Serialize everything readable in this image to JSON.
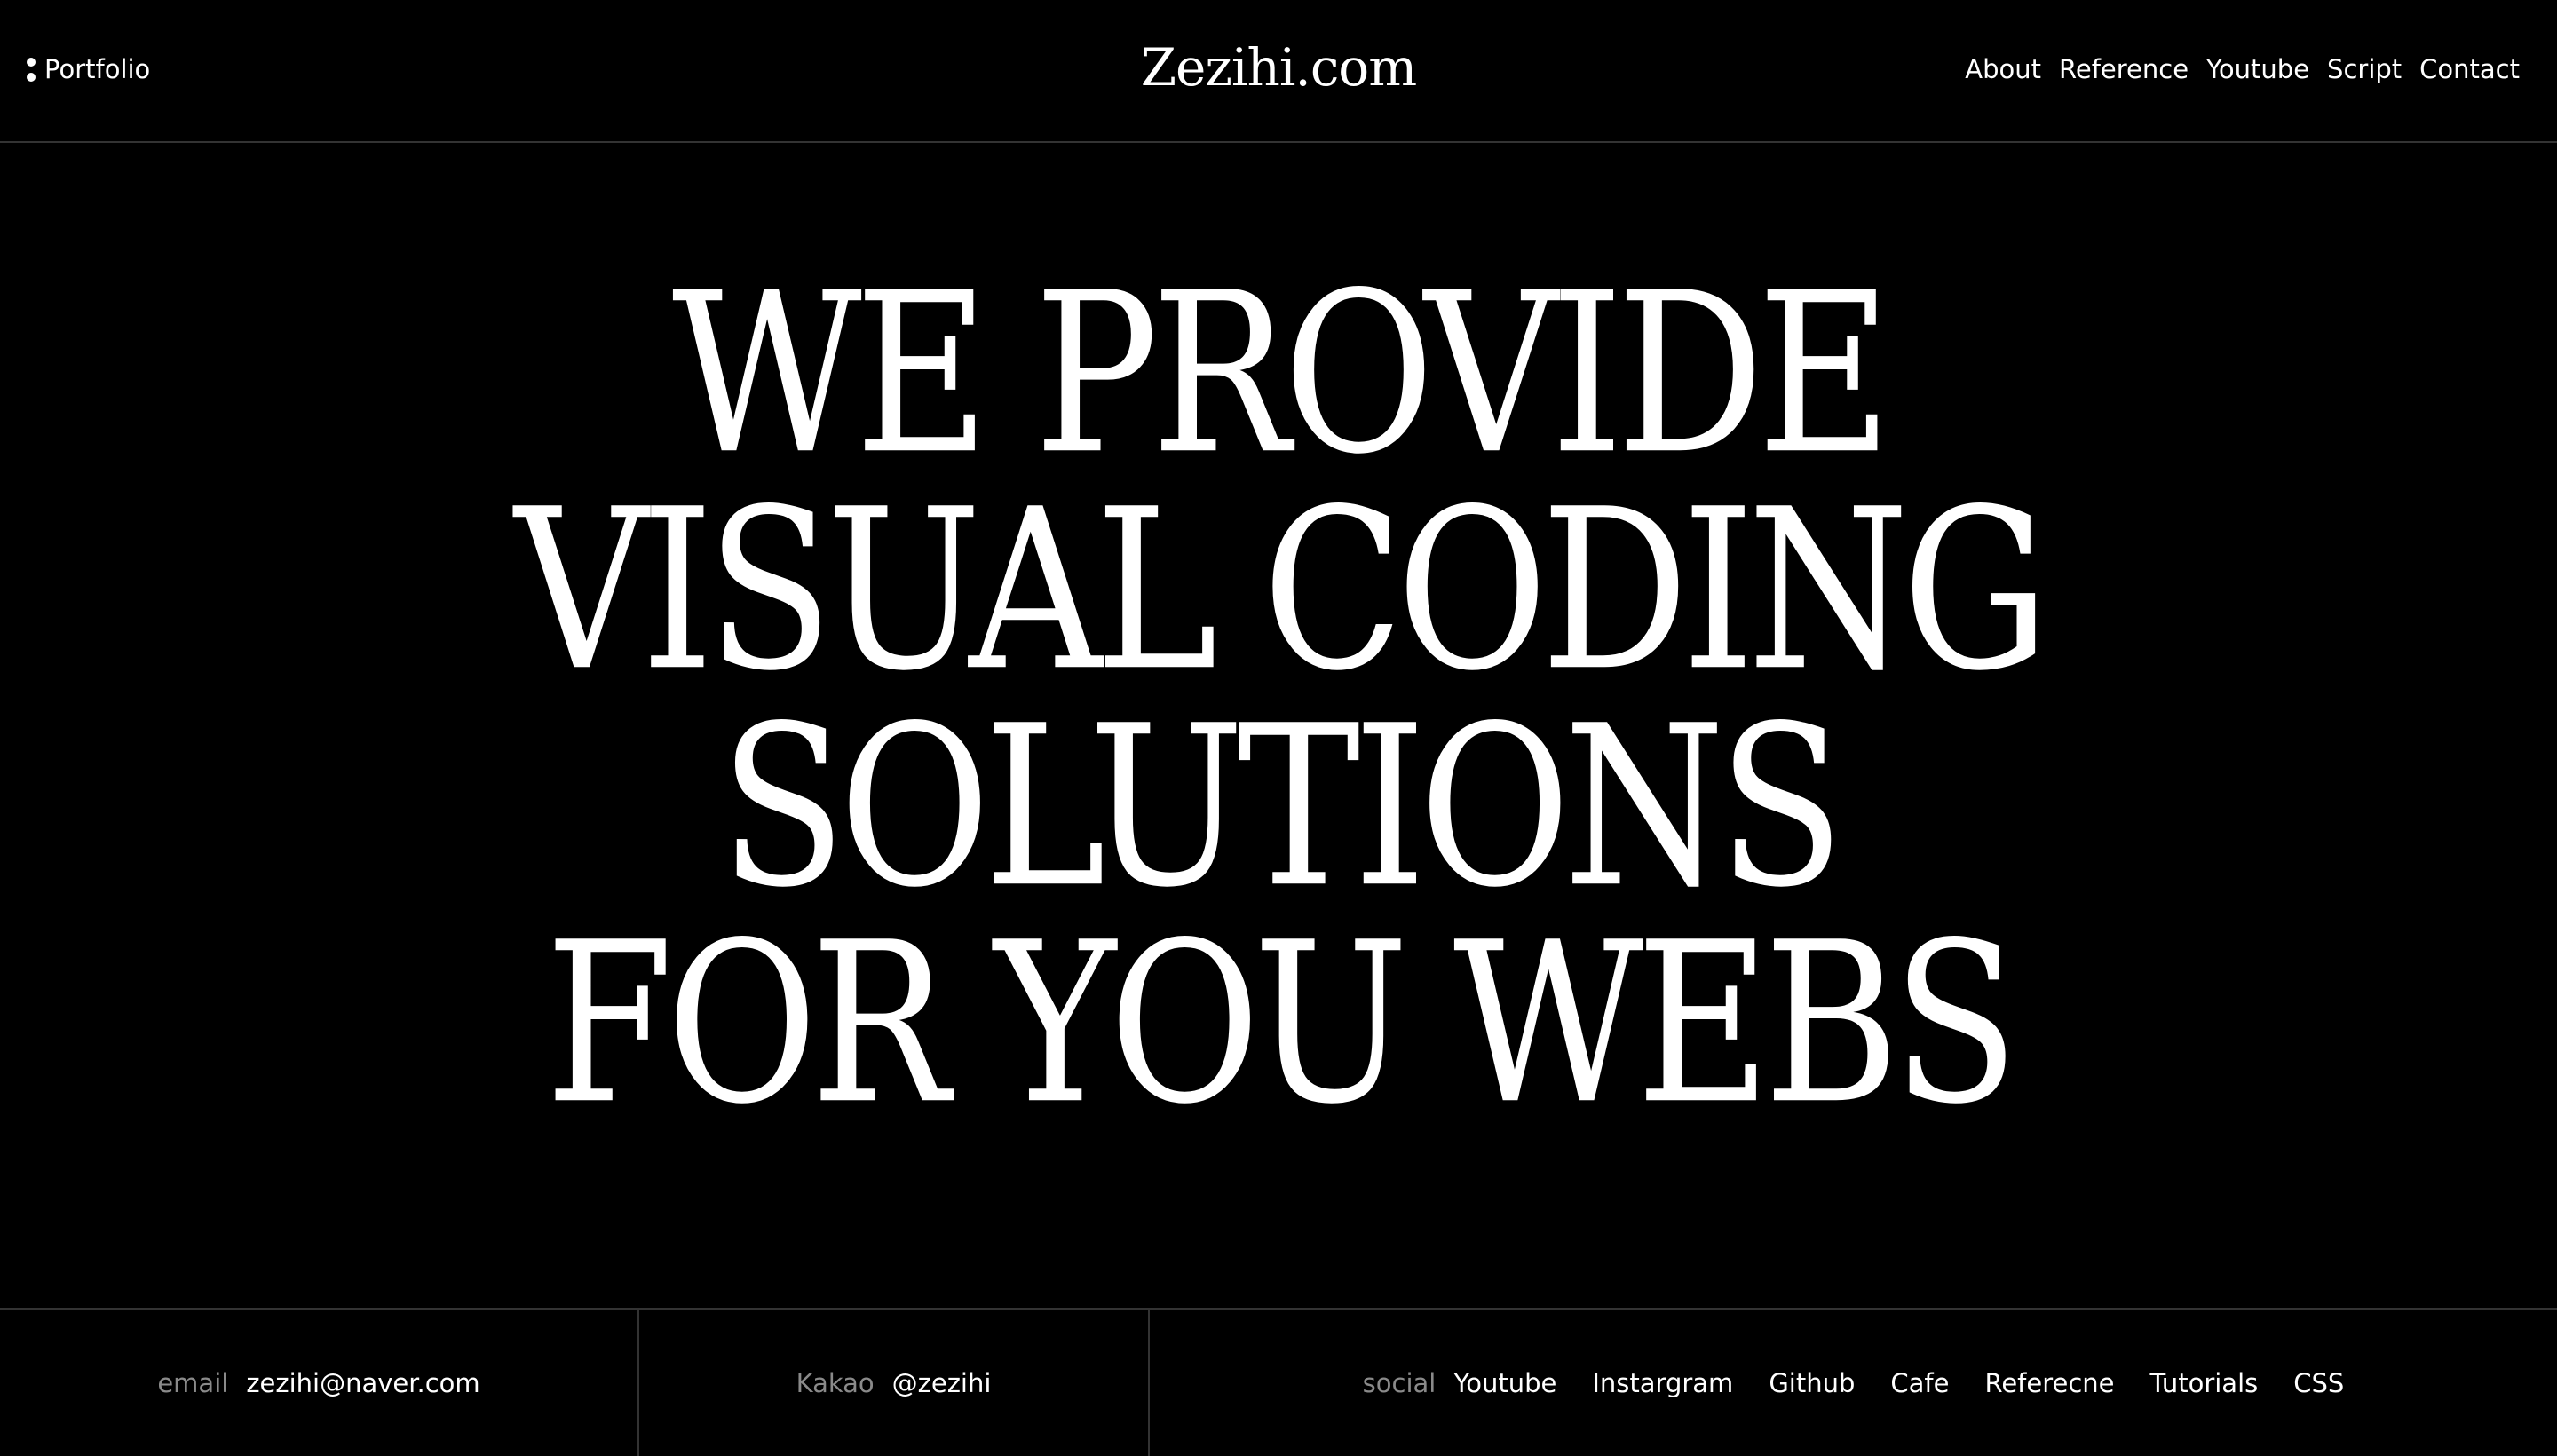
{
  "header": {
    "portfolio_label": "Portfolio",
    "site_title": "Zezihi.com",
    "nav": [
      "About",
      "Reference",
      "Youtube",
      "Script",
      "Contact"
    ]
  },
  "hero": {
    "lines": [
      "WE PROVIDE",
      "VISUAL CODING",
      "SOLUTIONS",
      "FOR YOU WEBS"
    ]
  },
  "footer": {
    "email_label": "email",
    "email_value": "zezihi@naver.com",
    "kakao_label": "Kakao",
    "kakao_value": "@zezihi",
    "social_label": "social",
    "social_links": [
      "Youtube",
      "Instargram",
      "Github",
      "Cafe",
      "Referecne",
      "Tutorials",
      "CSS"
    ]
  },
  "colors": {
    "background": "#000000",
    "text": "#ffffff",
    "muted_label": "#8a8a8a",
    "divider": "#333333"
  },
  "icons": {
    "portfolio": "dots-menu-icon"
  }
}
